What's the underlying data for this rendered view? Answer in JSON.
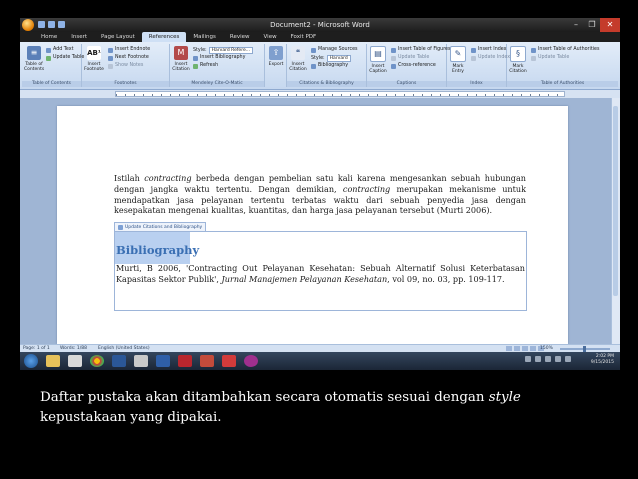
{
  "window": {
    "title": "Document2 - Microsoft Word",
    "min": "–",
    "max": "❐",
    "close": "✕"
  },
  "tabs": [
    "Home",
    "Insert",
    "Page Layout",
    "References",
    "Mailings",
    "Review",
    "View",
    "Foxit PDF"
  ],
  "active_tab": "References",
  "ribbon": {
    "toc": {
      "big": "Table of Contents",
      "add_text": "Add Text",
      "update_table": "Update Table",
      "label": "Table of Contents"
    },
    "footnotes": {
      "big": "Insert Footnote",
      "insert_endnote": "Insert Endnote",
      "next_footnote": "Next Footnote",
      "show_notes": "Show Notes",
      "label": "Footnotes"
    },
    "citations": {
      "big": "Insert Citation",
      "style_label": "Style:",
      "style_value": "Harvard Refere...",
      "insert_bibliography": "Insert Bibliography",
      "refresh": "Refresh",
      "label": "Mendeley Cite-O-Matic"
    },
    "export": {
      "big": "Export"
    },
    "bibliography": {
      "big": "Insert Citation",
      "manage_sources": "Manage Sources",
      "style_label": "Style:",
      "style_value": "Harvard",
      "bibliography": "Bibliography",
      "label": "Citations & Bibliography"
    },
    "captions": {
      "big": "Insert Caption",
      "insert_table_of_figures": "Insert Table of Figures",
      "update_table": "Update Table",
      "cross_reference": "Cross-reference",
      "label": "Captions"
    },
    "index": {
      "big": "Mark Entry",
      "insert_index": "Insert Index",
      "update_index": "Update Index",
      "label": "Index"
    },
    "authorities": {
      "big": "Mark Citation",
      "insert_table": "Insert Table of Authorities",
      "update_table": "Update Table",
      "label": "Table of Authorities"
    }
  },
  "ruler": {
    "marks": "· 2 · · · 1 · · · · · 1 · · · 2 · · · 3 · · · 4 · · · 5 · · · 6 · · · 7 · · · 8 · · · 9 · · · 10 · · · 11 · · · 12 · · · 13 · · · 14 · · · 15 · · · 16 · · · 17 · · · 18 ·"
  },
  "document": {
    "p1_a": "Istilah ",
    "p1_i1": "contracting",
    "p1_b": " berbeda dengan pembelian satu kali karena mengesankan sebuah hubungan dengan jangka waktu tertentu. Dengan demikian, ",
    "p1_i2": "contracting",
    "p1_c": " merupakan mekanisme untuk mendapatkan jasa pelayanan tertentu terbatas waktu dari sebuah penyedia jasa dengan kesepakatan mengenai kualitas, kuantitas, dan harga jasa pelayanan tersebut (Murti 2006).",
    "bib_tab": "Update Citations and Bibliography",
    "bib_heading": "Bibliography",
    "bib_a": "Murti, B 2006, 'Contracting Out Pelayanan Kesehatan: Sebuah Alternatif Solusi Keterbatasan Kapasitas Sektor Publik', ",
    "bib_i": "Jurnal Manajemen Pelayanan Kesehatan",
    "bib_b": ", vol 09, no. 03, pp. 109-117."
  },
  "status": {
    "page": "Page: 1 of 1",
    "words": "Words: 1/88",
    "lang": "English (United States)",
    "zoom": "150%"
  },
  "taskbar": {
    "time": "2:02 PM",
    "date": "9/15/2015"
  },
  "caption": {
    "a": "Daftar pustaka akan ditambahkan secara otomatis sesuai dengan ",
    "i": "style",
    "b": " kepustakaan yang dipakai."
  }
}
